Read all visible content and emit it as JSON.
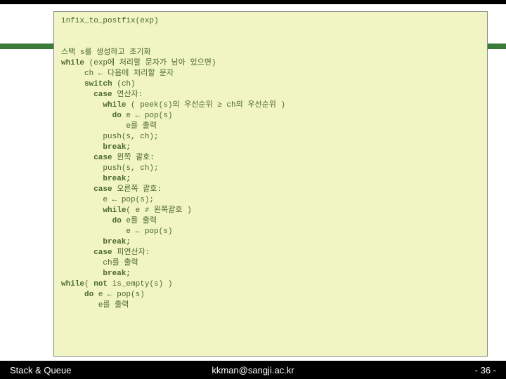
{
  "code": {
    "l1": "infix_to_postfix(exp)",
    "l2": "",
    "l3": "",
    "l4": "스택 s를 생성하고 초기화",
    "l5a": "while",
    "l5b": " (exp에 처리할 문자가 남아 있으면)",
    "l6": "     ch ← 다음에 처리할 문자",
    "l7a": "     switch",
    "l7b": " (ch)",
    "l8a": "       case",
    "l8b": " 연산자:",
    "l9a": "         while",
    "l9b": " ( peek(s)의 우선순위 ≥ ch의 우선순위 )",
    "l10a": "           do",
    "l10b": " e ← pop(s)",
    "l11": "              e를 출력",
    "l12": "         push(s, ch);",
    "l13": "         break;",
    "l14a": "       case",
    "l14b": " 왼쪽 괄호:",
    "l15": "         push(s, ch);",
    "l16": "         break;",
    "l17a": "       case",
    "l17b": " 오른쪽 괄호:",
    "l18": "         e ← pop(s);",
    "l19a": "         while",
    "l19b": "( e ≠ 왼쪽괄호 )",
    "l20a": "           do",
    "l20b": " e를 출력",
    "l21": "              e ← pop(s)",
    "l22": "         break;",
    "l23a": "       case",
    "l23b": " 피연산자:",
    "l24": "         ch를 출력",
    "l25": "         break;",
    "l26a": "while",
    "l26b": "( ",
    "l26c": "not",
    "l26d": " is_empty(s) )",
    "l27a": "     do",
    "l27b": " e ← pop(s)",
    "l28": "        e를 출력"
  },
  "footer": {
    "left": "Stack & Queue",
    "center": "kkman@sangji.ac.kr",
    "right": "- 36 -"
  }
}
